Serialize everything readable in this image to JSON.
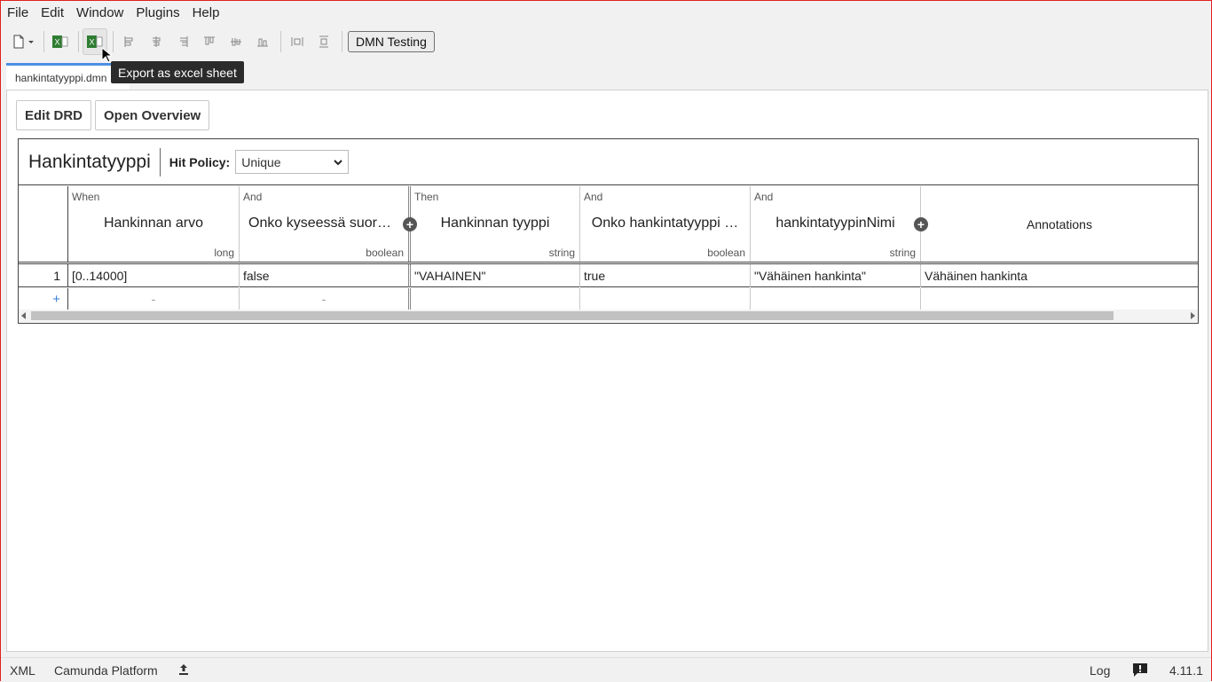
{
  "menu": [
    "File",
    "Edit",
    "Window",
    "Plugins",
    "Help"
  ],
  "toolbar": {
    "dmn_testing_label": "DMN Testing",
    "tooltip": "Export as excel sheet"
  },
  "tab": {
    "label": "hankintatyyppi.dmn"
  },
  "actions": {
    "edit_drd": "Edit DRD",
    "open_overview": "Open Overview"
  },
  "decision": {
    "name": "Hankintatyyppi",
    "hit_policy_label": "Hit Policy:",
    "hit_policy_value": "Unique",
    "columns": [
      {
        "kind": "When",
        "label": "Hankinnan arvo",
        "type": "long"
      },
      {
        "kind": "And",
        "label": "Onko kyseessä suora…",
        "type": "boolean"
      },
      {
        "kind": "Then",
        "label": "Hankinnan tyyppi",
        "type": "string"
      },
      {
        "kind": "And",
        "label": "Onko hankintatyyppi …",
        "type": "boolean"
      },
      {
        "kind": "And",
        "label": "hankintatyypinNimi",
        "type": "string"
      },
      {
        "kind": "",
        "label": "Annotations",
        "type": ""
      }
    ],
    "rows": [
      {
        "index": "1",
        "cells": [
          "[0..14000]",
          "false",
          "\"VAHAINEN\"",
          "true",
          "\"Vähäinen hankinta\"",
          "Vähäinen hankinta"
        ]
      }
    ],
    "new_row": {
      "add": "+",
      "placeholders": [
        "-",
        "-"
      ]
    }
  },
  "status": {
    "xml": "XML",
    "platform": "Camunda Platform",
    "log": "Log",
    "version": "4.11.1"
  }
}
